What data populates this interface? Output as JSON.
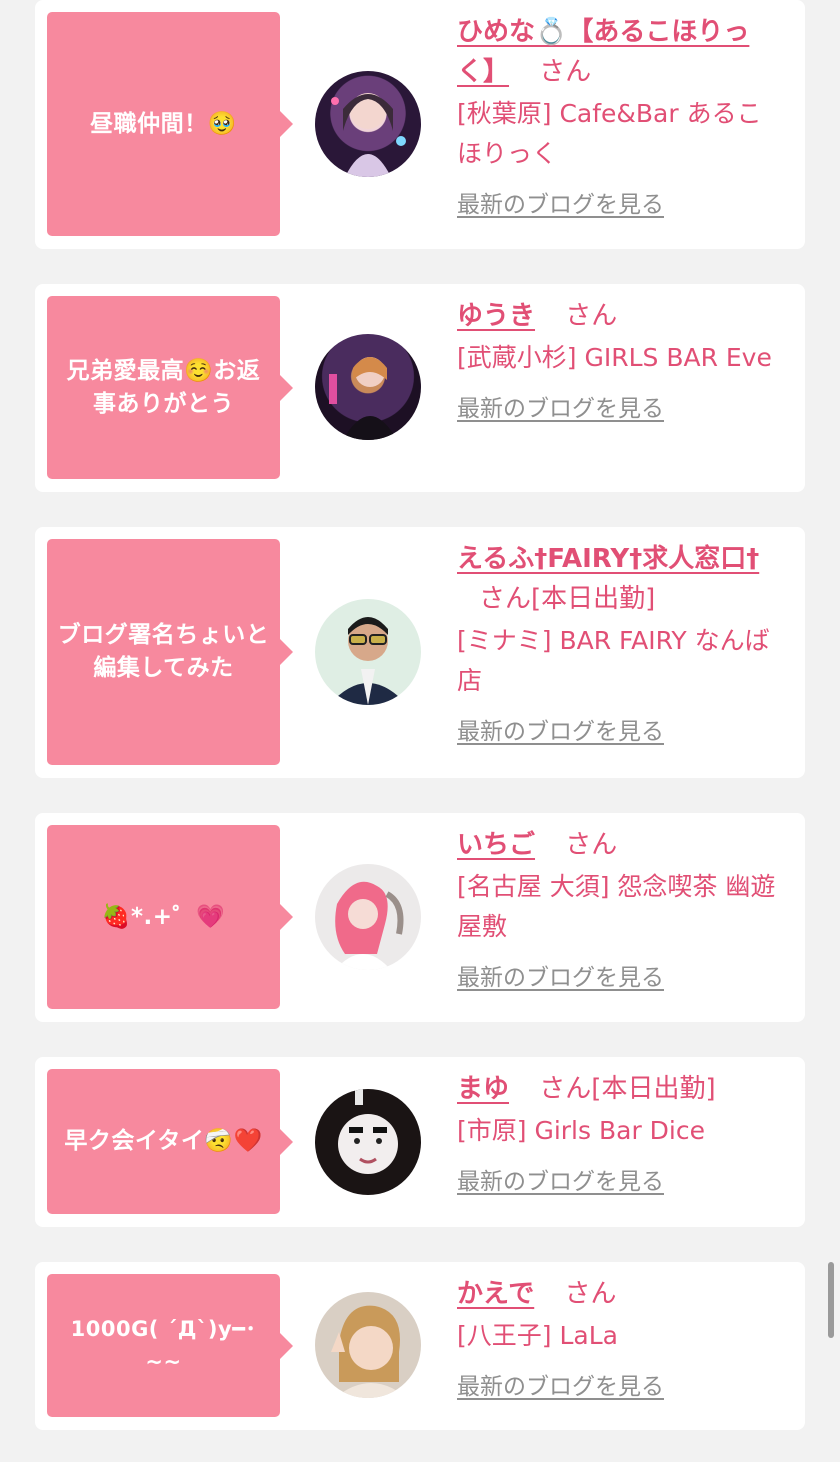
{
  "entries": [
    {
      "message": "昼職仲間！🥹",
      "name": "ひめな💍【あるこほりっく】",
      "san": "さん",
      "status": "",
      "shop": "[秋葉原] Cafe&Bar あるこほりっく",
      "blog_link": "最新のブログを見る",
      "avatar_icon": "avatar-photo"
    },
    {
      "message": "兄弟愛最高☺️お返事ありがとう",
      "name": "ゆうき",
      "san": "さん",
      "status": "",
      "shop": "[武蔵小杉] GIRLS BAR Eve",
      "blog_link": "最新のブログを見る",
      "avatar_icon": "avatar-photo"
    },
    {
      "message": "ブログ署名ちょいと編集してみた",
      "name": "えるふ†FAIRY†求人窓口†",
      "san": "さん",
      "status": "[本日出勤]",
      "shop": "[ミナミ] BAR FAIRY なんば店",
      "blog_link": "最新のブログを見る",
      "avatar_icon": "avatar-photo"
    },
    {
      "message": "🍓*.+゜💗",
      "name": "いちご",
      "san": "さん",
      "status": "",
      "shop": "[名古屋 大須] 怨念喫茶 幽遊屋敷",
      "blog_link": "最新のブログを見る",
      "avatar_icon": "avatar-photo"
    },
    {
      "message": "早ク会イタイ🤕❤️",
      "name": "まゆ",
      "san": "さん",
      "status": "[本日出勤]",
      "shop": "[市原] Girls Bar Dice",
      "blog_link": "最新のブログを見る",
      "avatar_icon": "avatar-photo"
    },
    {
      "message": "1000G( ´Д`)y━･~~",
      "name": "かえで",
      "san": "さん",
      "status": "",
      "shop": "[八王子] LaLa",
      "blog_link": "最新のブログを見る",
      "avatar_icon": "avatar-photo"
    }
  ],
  "colors": {
    "bubble": "#f7899e",
    "name": "#e14f75",
    "link": "#8f8f8f",
    "background": "#f2f2f2"
  }
}
